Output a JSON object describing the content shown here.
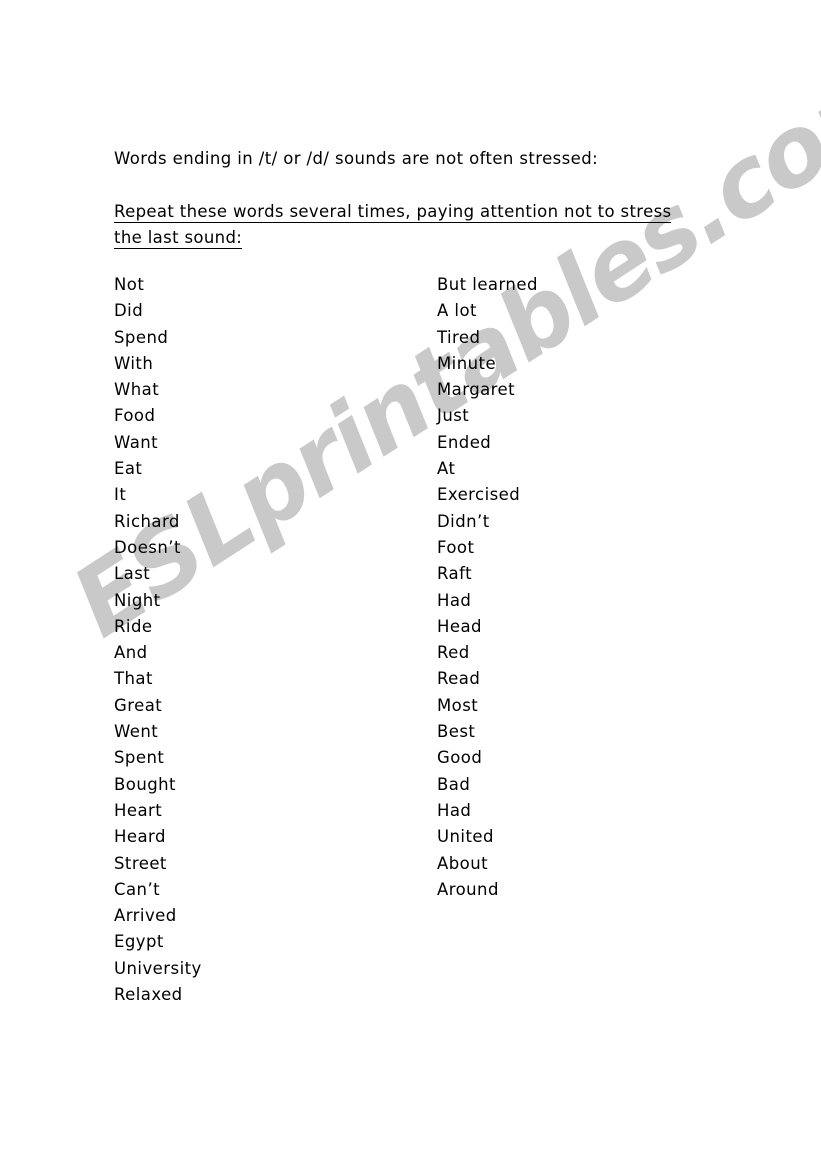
{
  "document": {
    "title_line": "Words ending in /t/ or /d/ sounds are not often stressed:",
    "instruction_line_1": "Repeat these words several times, paying attention not to stress",
    "instruction_line_2": "the last sound:"
  },
  "watermark": {
    "text": "ESLprintables.com",
    "color": "#c9c9c9",
    "rotation_deg": -33
  },
  "columns": {
    "left": [
      "Not",
      "Did",
      "Spend",
      "With",
      "What",
      "Food",
      "Want",
      "Eat",
      "It",
      "Richard",
      "Doesn’t",
      "Last",
      "Night",
      "Ride",
      "And",
      "That",
      "Great",
      "Went",
      "Spent",
      "Bought",
      "Heart",
      "Heard",
      "Street",
      "Can’t",
      "Arrived",
      "Egypt",
      "University",
      "Relaxed"
    ],
    "right": [
      "But learned",
      "A lot",
      "Tired",
      "Minute",
      "Margaret",
      "Just",
      "Ended",
      "At",
      "Exercised",
      "Didn’t",
      "Foot",
      "Raft",
      "Had",
      "Head",
      "Red",
      "Read",
      "Most",
      "Best",
      "Good",
      "Bad",
      "Had",
      "United",
      "About",
      "Around"
    ]
  },
  "page": {
    "background_color": "#ffffff",
    "text_color": "#000000"
  }
}
